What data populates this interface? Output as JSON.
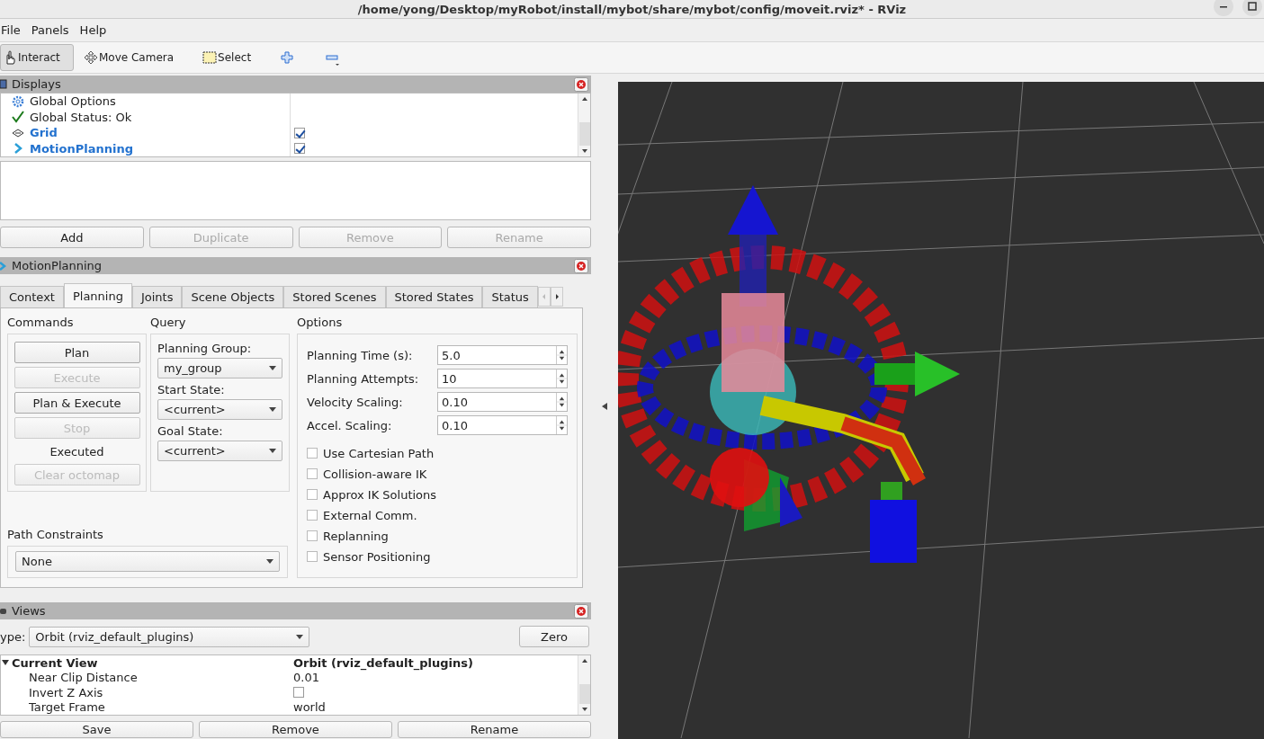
{
  "window": {
    "title": "/home/yong/Desktop/myRobot/install/mybot/share/mybot/config/moveit.rviz* - RViz"
  },
  "menu": [
    {
      "label": "File"
    },
    {
      "label": "Panels"
    },
    {
      "label": "Help"
    }
  ],
  "toolbar": [
    {
      "label": "Interact",
      "kind": "interact",
      "selected": true
    },
    {
      "label": "Move Camera",
      "kind": "move",
      "selected": false
    },
    {
      "label": "Select",
      "kind": "select",
      "selected": false
    }
  ],
  "displays": {
    "title": "Displays",
    "items": [
      {
        "label": "Global Options",
        "kind": "options"
      },
      {
        "label": "Global Status: Ok",
        "kind": "status"
      },
      {
        "label": "Grid",
        "kind": "display",
        "checked": true
      },
      {
        "label": "MotionPlanning",
        "kind": "display",
        "checked": true
      }
    ],
    "buttons": [
      {
        "label": "Add",
        "disabled": false
      },
      {
        "label": "Duplicate",
        "disabled": true
      },
      {
        "label": "Remove",
        "disabled": true
      },
      {
        "label": "Rename",
        "disabled": true
      }
    ]
  },
  "motion_planning": {
    "title": "MotionPlanning",
    "tabs": [
      {
        "label": "Context",
        "selected": false
      },
      {
        "label": "Planning",
        "selected": true
      },
      {
        "label": "Joints",
        "selected": false
      },
      {
        "label": "Scene Objects",
        "selected": false
      },
      {
        "label": "Stored Scenes",
        "selected": false
      },
      {
        "label": "Stored States",
        "selected": false
      },
      {
        "label": "Status",
        "selected": false
      }
    ],
    "commands": {
      "title": "Commands",
      "items": [
        {
          "kind": "button",
          "label": "Plan",
          "disabled": false
        },
        {
          "kind": "button",
          "label": "Execute",
          "disabled": true
        },
        {
          "kind": "button",
          "label": "Plan & Execute",
          "disabled": false
        },
        {
          "kind": "button",
          "label": "Stop",
          "disabled": true
        },
        {
          "kind": "status",
          "label": "Executed"
        },
        {
          "kind": "button",
          "label": "Clear octomap",
          "disabled": true
        }
      ]
    },
    "query": {
      "title": "Query",
      "fields": [
        {
          "label": "Planning Group:",
          "value": "my_group"
        },
        {
          "label": "Start State:",
          "value": "<current>"
        },
        {
          "label": "Goal State:",
          "value": "<current>"
        }
      ]
    },
    "options": {
      "title": "Options",
      "spinners": [
        {
          "label": "Planning Time (s):",
          "value": "5.0"
        },
        {
          "label": "Planning Attempts:",
          "value": "10"
        },
        {
          "label": "Velocity Scaling:",
          "value": "0.10"
        },
        {
          "label": "Accel. Scaling:",
          "value": "0.10"
        }
      ],
      "checks": [
        {
          "label": "Use Cartesian Path",
          "checked": false
        },
        {
          "label": "Collision-aware IK",
          "checked": false
        },
        {
          "label": "Approx IK Solutions",
          "checked": false
        },
        {
          "label": "External Comm.",
          "checked": false
        },
        {
          "label": "Replanning",
          "checked": false
        },
        {
          "label": "Sensor Positioning",
          "checked": false
        }
      ]
    },
    "path_constraints": {
      "title": "Path Constraints",
      "value": "None"
    }
  },
  "views": {
    "title": "Views",
    "type_label": "ype:",
    "type_value": "Orbit (rviz_default_plugins)",
    "zero": "Zero",
    "rows": [
      {
        "name": "Current View",
        "value": "Orbit (rviz_default_plugins)",
        "kind": "header"
      },
      {
        "name": "Near Clip Distance",
        "value": "0.01",
        "kind": "text"
      },
      {
        "name": "Invert Z Axis",
        "kind": "check",
        "checked": false
      },
      {
        "name": "Target Frame",
        "value": "world",
        "kind": "text"
      }
    ],
    "buttons": [
      {
        "label": "Save"
      },
      {
        "label": "Remove"
      },
      {
        "label": "Rename"
      }
    ]
  }
}
